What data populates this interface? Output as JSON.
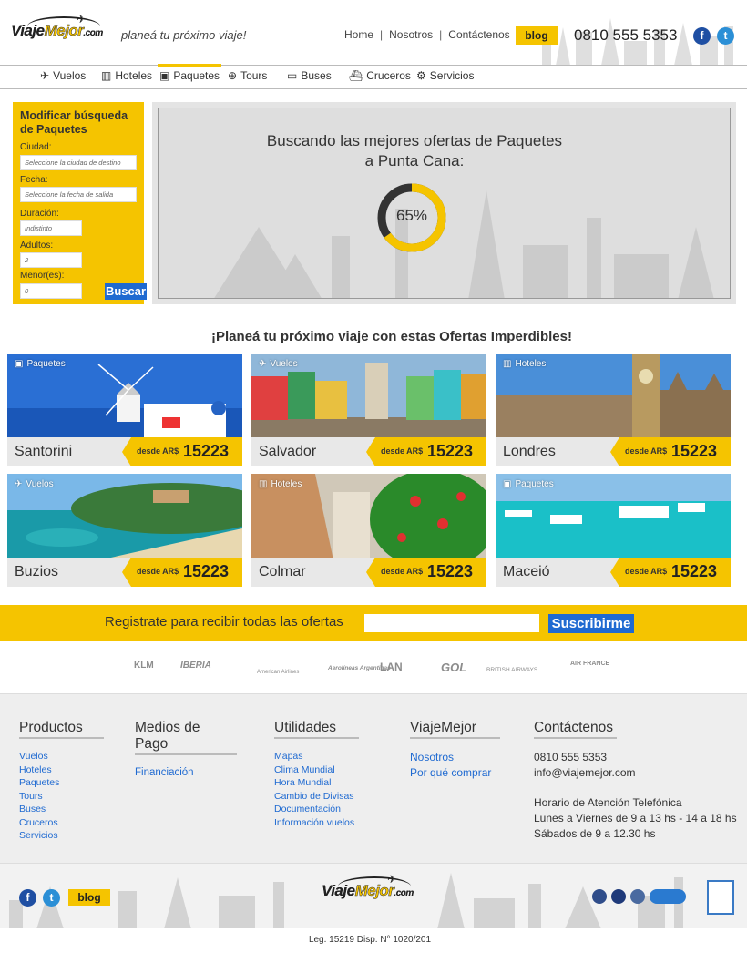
{
  "header": {
    "logo_text_a": "Viaje",
    "logo_text_b": "Mejor",
    "logo_text_c": ".com",
    "tagline": "planeá tu próximo viaje!",
    "nav": [
      "Home",
      "Nosotros",
      "Contáctenos"
    ],
    "blog_label": "blog",
    "phone": "0810 555 5353",
    "facebook_icon": "facebook-icon",
    "twitter_icon": "twitter-icon"
  },
  "categories": [
    {
      "label": "Vuelos",
      "icon": "plane-icon"
    },
    {
      "label": "Hoteles",
      "icon": "hotel-icon"
    },
    {
      "label": "Paquetes",
      "icon": "suitcase-icon",
      "active": true
    },
    {
      "label": "Tours",
      "icon": "globe-icon"
    },
    {
      "label": "Buses",
      "icon": "bus-icon"
    },
    {
      "label": "Cruceros",
      "icon": "ship-icon"
    },
    {
      "label": "Servicios",
      "icon": "services-icon"
    }
  ],
  "search": {
    "title": "Modificar búsqueda de Paquetes",
    "city_label": "Ciudad:",
    "city_placeholder": "Seleccione la ciudad de destino",
    "date_label": "Fecha:",
    "date_placeholder": "Seleccione la fecha de salida",
    "duration_label": "Duración:",
    "duration_value": "Indistinto",
    "adults_label": "Adultos:",
    "adults_value": "2",
    "minors_label": "Menor(es):",
    "minors_value": "0",
    "button": "Buscar"
  },
  "loading": {
    "title_line1": "Buscando las mejores ofertas de Paquetes",
    "title_line2": "a Punta Cana:",
    "progress_percent": 65,
    "progress_label": "65%"
  },
  "offers": {
    "title": "¡Planeá tu próximo viaje con estas Ofertas Imperdibles!",
    "price_from": "desde AR$",
    "items": [
      {
        "tag": "Paquetes",
        "tag_icon": "suitcase-icon",
        "city": "Santorini",
        "price": "15223"
      },
      {
        "tag": "Vuelos",
        "tag_icon": "plane-icon",
        "city": "Salvador",
        "price": "15223"
      },
      {
        "tag": "Hoteles",
        "tag_icon": "hotel-icon",
        "city": "Londres",
        "price": "15223"
      },
      {
        "tag": "Vuelos",
        "tag_icon": "plane-icon",
        "city": "Buzios",
        "price": "15223"
      },
      {
        "tag": "Hoteles",
        "tag_icon": "hotel-icon",
        "city": "Colmar",
        "price": "15223"
      },
      {
        "tag": "Paquetes",
        "tag_icon": "suitcase-icon",
        "city": "Maceió",
        "price": "15223"
      }
    ]
  },
  "register": {
    "text": "Registrate para recibir todas las ofertas",
    "button": "Suscribirme"
  },
  "airlines": [
    "KLM",
    "IBERIA",
    "American Airlines",
    "Aerolíneas Argentinas",
    "LAN",
    "GOL",
    "BRITISH AIRWAYS",
    "AIR FRANCE"
  ],
  "footer": {
    "productos": {
      "title": "Productos",
      "items": [
        "Vuelos",
        "Hoteles",
        "Paquetes",
        "Tours",
        "Buses",
        "Cruceros",
        "Servicios"
      ]
    },
    "pago": {
      "title": "Medios de Pago",
      "items": [
        "Financiación"
      ]
    },
    "utilidades": {
      "title": "Utilidades",
      "items": [
        "Mapas",
        "Clima Mundial",
        "Hora Mundial",
        "Cambio de Divisas",
        "Documentación",
        "Información vuelos"
      ]
    },
    "viajemejor": {
      "title": "ViajeMejor",
      "items": [
        "Nosotros",
        "Por qué comprar"
      ]
    },
    "contacto": {
      "title": "Contáctenos",
      "phone": "0810 555 5353",
      "email": "info@viajemejor.com",
      "hours_title": "Horario de Atención Telefónica",
      "hours_1": "Lunes a Viernes de 9 a 13 hs - 14 a 18 hs",
      "hours_2": "Sábados de 9 a 12.30 hs"
    },
    "blog_label": "blog",
    "legal": "Leg. 15219 Disp. N° 1020/201"
  },
  "colors": {
    "accent": "#f5c400",
    "button_blue": "#1f6ad1",
    "link_blue": "#1f6ad1"
  }
}
